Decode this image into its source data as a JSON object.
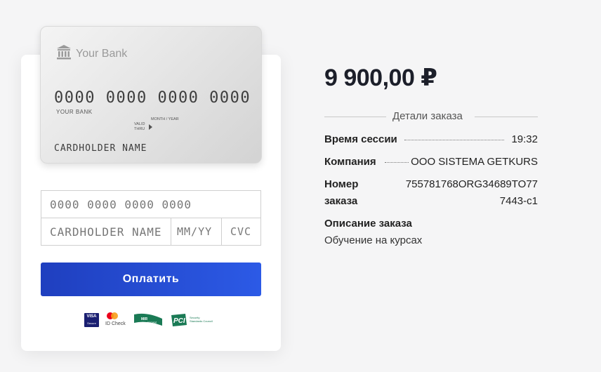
{
  "card_preview": {
    "bank_name": "Your Bank",
    "number": "0000 0000 0000 0000",
    "bank_small": "YOUR BANK",
    "valid_thru": "VALID THRU",
    "month_year": "MONTH / YEAR",
    "holder": "CARDHOLDER NAME"
  },
  "form": {
    "card_number_placeholder": "0000 0000 0000 0000",
    "holder_placeholder": "CARDHOLDER NAME",
    "expiry_placeholder": "MM/YY",
    "cvc_placeholder": "CVC",
    "pay_label": "Оплатить"
  },
  "logos": {
    "visa": "VISA",
    "visa_sub": "Secure",
    "mastercard_label": "ID Check",
    "mir": "MIR Accept",
    "pci": "PCI",
    "pci_sub": "Security Standards Council"
  },
  "summary": {
    "amount": "9 900,00 ₽",
    "details_title": "Детали заказа",
    "session_label": "Время сессии",
    "session_value": "19:32",
    "company_label": "Компания",
    "company_value": "ООО SISTEMA GETKURS",
    "order_label_1": "Номер",
    "order_label_2": "заказа",
    "order_value_1": "755781768ORG34689TO77",
    "order_value_2": "7443-c1",
    "description_label": "Описание заказа",
    "description_value": "Обучение на курсах"
  },
  "colors": {
    "pay_button_start": "#1f3fbf",
    "pay_button_end": "#2c5ae6",
    "background": "#f5f5f6"
  }
}
